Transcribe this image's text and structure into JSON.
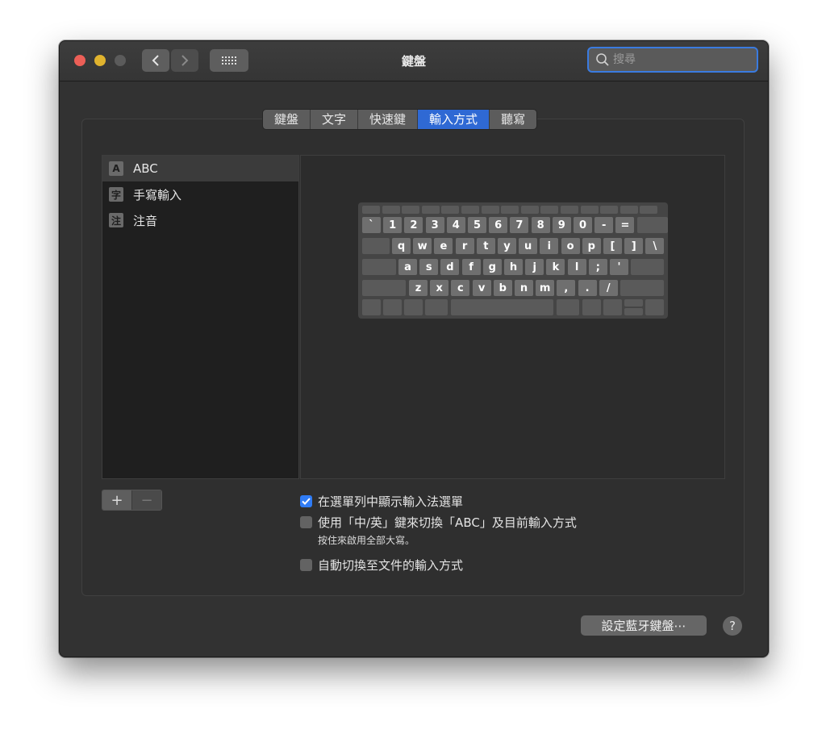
{
  "window": {
    "title": "鍵盤",
    "search_placeholder": "搜尋",
    "nav_back": "‹",
    "nav_forward": "›"
  },
  "tabs": [
    {
      "label": "鍵盤",
      "active": false
    },
    {
      "label": "文字",
      "active": false
    },
    {
      "label": "快速鍵",
      "active": false
    },
    {
      "label": "輸入方式",
      "active": true
    },
    {
      "label": "聽寫",
      "active": false
    }
  ],
  "input_sources": [
    {
      "badge": "A",
      "label": "ABC",
      "selected": true
    },
    {
      "badge": "字",
      "label": "手寫輸入",
      "selected": false
    },
    {
      "badge": "注",
      "label": "注音",
      "selected": false
    }
  ],
  "list_buttons": {
    "add": "+",
    "remove": "−"
  },
  "keyboard_rows": [
    [
      "`",
      "1",
      "2",
      "3",
      "4",
      "5",
      "6",
      "7",
      "8",
      "9",
      "0",
      "-",
      "="
    ],
    [
      "q",
      "w",
      "e",
      "r",
      "t",
      "y",
      "u",
      "i",
      "o",
      "p",
      "[",
      "]",
      "\\"
    ],
    [
      "a",
      "s",
      "d",
      "f",
      "g",
      "h",
      "j",
      "k",
      "l",
      ";",
      "'"
    ],
    [
      "z",
      "x",
      "c",
      "v",
      "b",
      "n",
      "m",
      ",",
      ".",
      "/"
    ]
  ],
  "options": {
    "show_menu": {
      "label": "在選單列中顯示輸入法選單",
      "checked": true
    },
    "switch_key": {
      "label": "使用「中/英」鍵來切換「ABC」及目前輸入方式",
      "checked": false
    },
    "switch_note": "按住來啟用全部大寫。",
    "auto_switch": {
      "label": "自動切換至文件的輸入方式",
      "checked": false
    }
  },
  "footer": {
    "bluetooth_button": "設定藍牙鍵盤⋯",
    "help": "?"
  },
  "colors": {
    "accent": "#2f69d4",
    "checkbox_on": "#2f7cf6",
    "close": "#ec5f57",
    "minimize": "#e0b32e"
  }
}
